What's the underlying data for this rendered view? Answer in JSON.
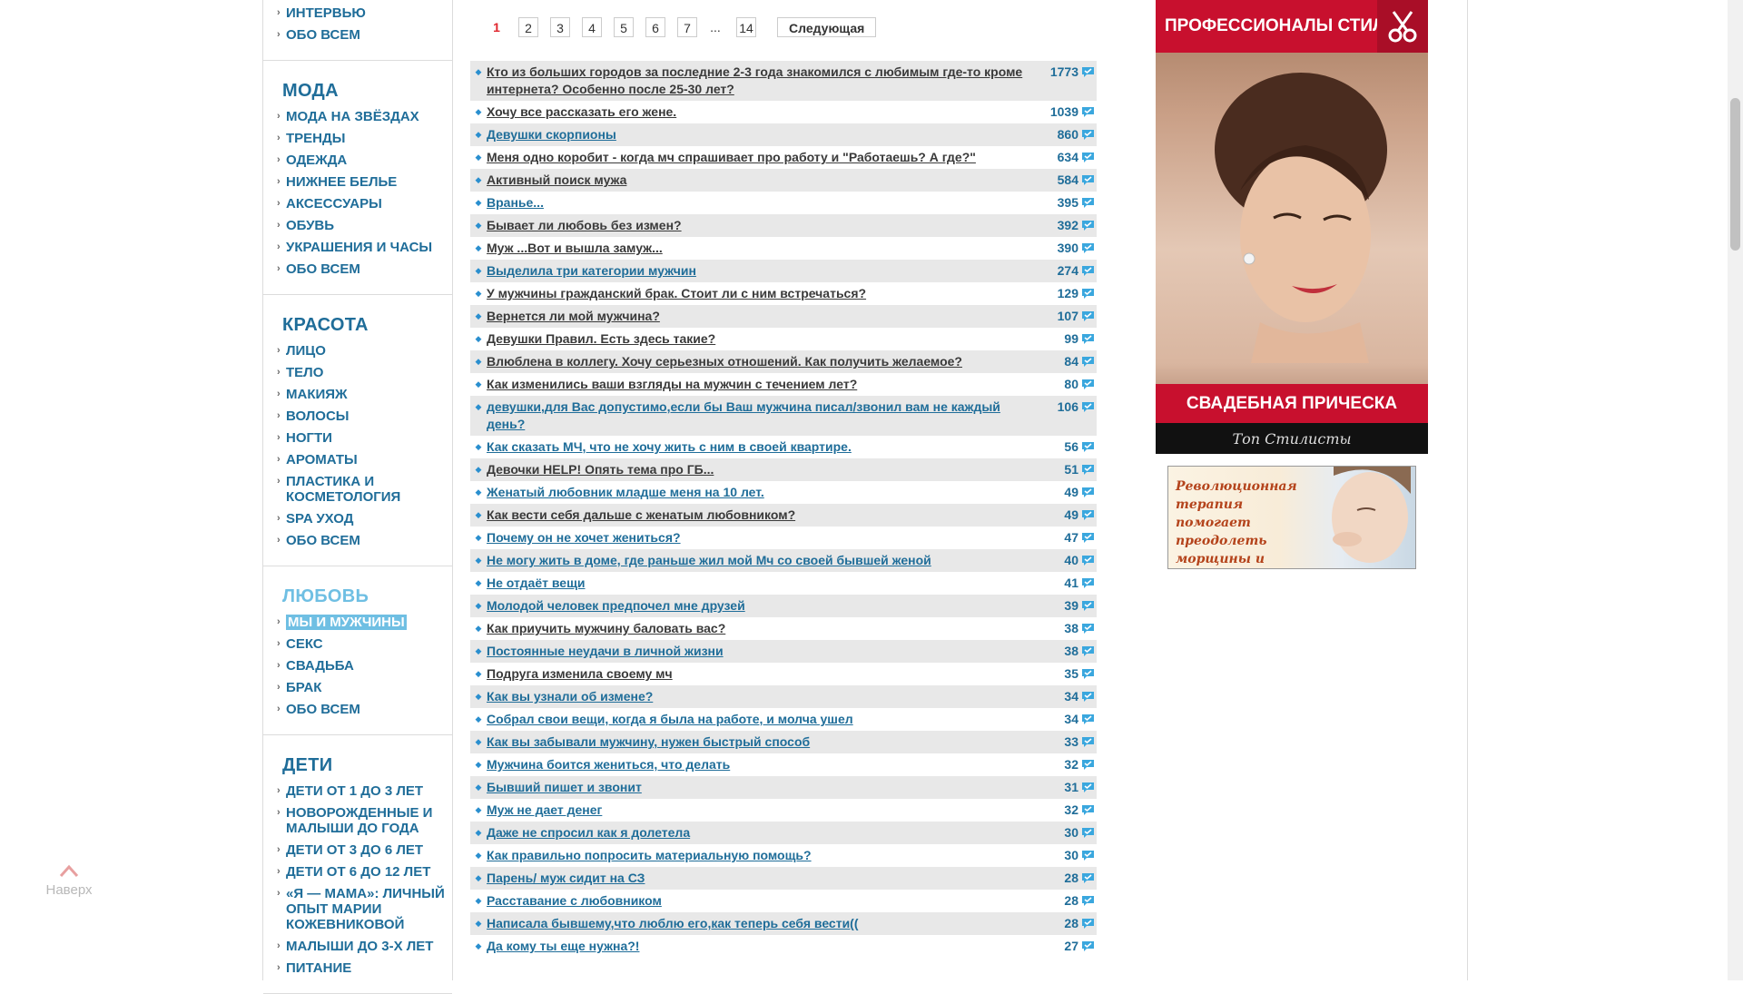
{
  "sidebar": {
    "sections": [
      {
        "heading": "",
        "items": [
          "ИНТЕРВЬЮ",
          "ОБО ВСЕМ"
        ]
      },
      {
        "heading": "МОДА",
        "items": [
          "МОДА НА ЗВЁЗДАХ",
          "ТРЕНДЫ",
          "ОДЕЖДА",
          "НИЖНЕЕ БЕЛЬЕ",
          "АКСЕССУАРЫ",
          "ОБУВЬ",
          "УКРАШЕНИЯ И ЧАСЫ",
          "ОБО ВСЕМ"
        ]
      },
      {
        "heading": "КРАСОТА",
        "items": [
          "ЛИЦО",
          "ТЕЛО",
          "МАКИЯЖ",
          "ВОЛОСЫ",
          "НОГТИ",
          "АРОМАТЫ",
          "ПЛАСТИКА И КОСМЕТОЛОГИЯ",
          "SPA УХОД",
          "ОБО ВСЕМ"
        ]
      },
      {
        "heading": "ЛЮБОВЬ",
        "active": true,
        "items": [
          "МЫ И МУЖЧИНЫ",
          "СЕКС",
          "СВАДЬБА",
          "БРАК",
          "ОБО ВСЕМ"
        ],
        "selected": 0
      },
      {
        "heading": "ДЕТИ",
        "items": [
          "ДЕТИ ОТ 1 ДО 3 ЛЕТ",
          "НОВОРОЖДЕННЫЕ И МАЛЫШИ ДО ГОДА",
          "ДЕТИ ОТ 3 ДО 6 ЛЕТ",
          "ДЕТИ ОТ 6 ДО 12 ЛЕТ",
          "«Я — МАМА»: ЛИЧНЫЙ ОПЫТ МАРИИ КОЖЕВНИКОВОЙ",
          "МАЛЫШИ ДО 3-Х ЛЕТ",
          "ПИТАНИЕ"
        ]
      }
    ]
  },
  "pager": {
    "pages": [
      "1",
      "2",
      "3",
      "4",
      "5",
      "6",
      "7",
      "...",
      "14"
    ],
    "current": "1",
    "next_label": "Следующая"
  },
  "topics": [
    {
      "title": "Кто из больших городов за последние 2-3 года знакомился с любимым где-то кроме интернета? Особенно после 25-30 лет?",
      "count": "1773",
      "visited": true
    },
    {
      "title": "Хочу все рассказать его жене.",
      "count": "1039",
      "visited": true
    },
    {
      "title": "Девушки скорпионы",
      "count": "860"
    },
    {
      "title": "Меня одно коробит - когда мч спрашивает про работу и \"Работаешь? А где?\"",
      "count": "634",
      "visited": true
    },
    {
      "title": "Активный поиск мужа",
      "count": "584",
      "visited": true
    },
    {
      "title": "Вранье...",
      "count": "395"
    },
    {
      "title": "Бывает ли любовь без измен?",
      "count": "392",
      "visited": true
    },
    {
      "title": "Муж ...Вот и вышла замуж...",
      "count": "390",
      "visited": true
    },
    {
      "title": "Выделила три категории мужчин",
      "count": "274"
    },
    {
      "title": "У мужчины гражданский брак. Стоит ли с ним встречаться?",
      "count": "129",
      "visited": true
    },
    {
      "title": "Вернется ли мой мужчина?",
      "count": "107",
      "visited": true
    },
    {
      "title": "Девушки Правил. Есть здесь такие?",
      "count": "99",
      "visited": true
    },
    {
      "title": "Влюблена в коллегу. Хочу серьезных отношений. Как получить желаемое?",
      "count": "84",
      "visited": true
    },
    {
      "title": "Как изменились ваши взгляды на мужчин с течением лет?",
      "count": "80",
      "visited": true
    },
    {
      "title": "девушки,для Вас допустимо,если бы Ваш мужчина писал/звонил вам не каждый день?",
      "count": "106"
    },
    {
      "title": "Как сказать МЧ, что не хочу жить с ним в своей квартире.",
      "count": "56"
    },
    {
      "title": "Девочки HELP! Опять тема про ГБ...",
      "count": "51",
      "visited": true
    },
    {
      "title": "Женатый любовник младше меня на 10 лет.",
      "count": "49"
    },
    {
      "title": "Как вести себя дальше с женатым любовником?",
      "count": "49",
      "visited": true
    },
    {
      "title": "Почему он не хочет жениться?",
      "count": "47"
    },
    {
      "title": "Не могу жить в доме, где раньше жил мой Мч со своей бывшей женой",
      "count": "40"
    },
    {
      "title": "Не отдаёт вещи",
      "count": "41"
    },
    {
      "title": "Молодой человек предпочел мне друзей",
      "count": "39"
    },
    {
      "title": "Как приучить мужчину баловать вас?",
      "count": "38",
      "visited": true
    },
    {
      "title": "Постоянные неудачи в личной жизни",
      "count": "38"
    },
    {
      "title": "Подруга изменила своему мч",
      "count": "35",
      "visited": true
    },
    {
      "title": "Как вы узнали об измене?",
      "count": "34"
    },
    {
      "title": "Собрал свои вещи, когда я была на работе, и молча ушел",
      "count": "34"
    },
    {
      "title": "Как вы забывали мужчину, нужен быстрый способ",
      "count": "33"
    },
    {
      "title": "Мужчина боится жениться, что делать",
      "count": "32"
    },
    {
      "title": "Бывший пишет и звонит",
      "count": "31"
    },
    {
      "title": "Муж не дает денег",
      "count": "32"
    },
    {
      "title": "Даже не спросил как я долетела",
      "count": "30"
    },
    {
      "title": "Как правильно попросить материальную помощь?",
      "count": "30"
    },
    {
      "title": "Парень/ муж сидит на СЗ",
      "count": "28"
    },
    {
      "title": "Расставание с любовником",
      "count": "28"
    },
    {
      "title": "Написала бывшему,что люблю его,как теперь себя вести((",
      "count": "28"
    },
    {
      "title": "Да кому ты еще нужна?!",
      "count": "27"
    }
  ],
  "ads": {
    "ad1_top": "ПРОФЕССИОНАЛЫ СТИЛЯ",
    "ad1_bottom": "СВАДЕБНАЯ ПРИЧЕСКА",
    "ad1_signature": "Топ Стилисты",
    "ad2_text": "Революционная терапия помогает преодолеть морщины и признаки усталости"
  },
  "back_to_top": "Наверх",
  "colors": {
    "link": "#1f6d99",
    "active_heading": "#6fbfe3",
    "current_page": "#e0262e",
    "ad_red": "#c8102e"
  }
}
